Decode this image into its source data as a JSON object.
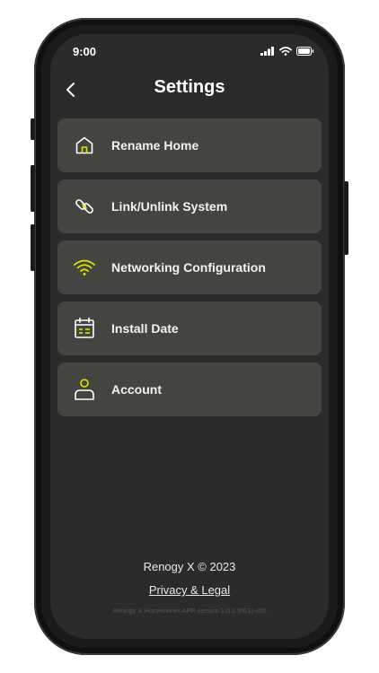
{
  "status_bar": {
    "time": "9:00"
  },
  "header": {
    "title": "Settings",
    "back_icon": "chevron-left-icon"
  },
  "menu": {
    "items": [
      {
        "label": "Rename Home",
        "icon": "home-icon"
      },
      {
        "label": "Link/Unlink System",
        "icon": "link-icon"
      },
      {
        "label": "Networking Configuration",
        "icon": "wifi-icon"
      },
      {
        "label": "Install Date",
        "icon": "calendar-icon"
      },
      {
        "label": "Account",
        "icon": "user-icon"
      }
    ]
  },
  "footer": {
    "copyright": "Renogy X © 2023",
    "privacy_link": "Privacy & Legal",
    "version": "Renogy X Homeowner APP version 1.0.0 (001)-v01"
  },
  "colors": {
    "background": "#2b2b2b",
    "card": "#444440",
    "accent": "#e5e000",
    "text": "#ffffff"
  }
}
